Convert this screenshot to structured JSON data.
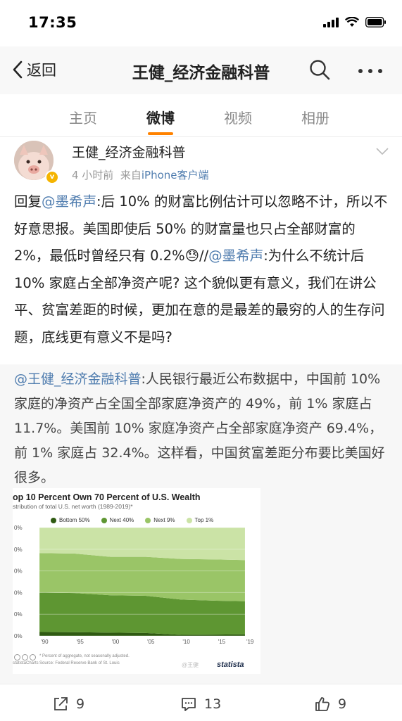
{
  "status_bar": {
    "time": "17:35"
  },
  "navbar": {
    "back_label": "返回",
    "title": "王健_经济金融科普"
  },
  "tabs": [
    {
      "label": "主页"
    },
    {
      "label": "微博"
    },
    {
      "label": "视频"
    },
    {
      "label": "相册"
    }
  ],
  "post": {
    "author": "王健_经济金融科普",
    "time_ago": "4 小时前",
    "source_prefix": "来自",
    "source": "iPhone客户端",
    "text": {
      "p1": "回复",
      "mention1": "@墨希声",
      "p2": ":后 10% 的财富比例估计可以忽略不计，所以不好意思报。美国即使后 50% 的财富量也只占全部财富的 2%，最低时曾经只有 0.2%",
      "emoji": "😓",
      "p3": "//",
      "mention2": "@墨希声",
      "p4": ":为什么不统计后 10% 家庭占全部净资产呢? 这个貌似更有意义，我们在讲公平、贫富差距的时候，更加在意的是最差的最穷的人的生存问题，底线更有意义不是吗?"
    }
  },
  "repost": {
    "mention": "@王健_经济金融科普",
    "text": ":人民银行最近公布数据中，中国前 10% 家庭的净资产占全国全部家庭净资产的 49%，前 1% 家庭占 11.7%。美国前 10% 家庭净资产占全部家庭净资产 69.4%，前 1% 家庭占 32.4%。这样看，中国贫富差距分布要比美国好很多。"
  },
  "chart_data": {
    "type": "area",
    "title": "op 10 Percent Own 70 Percent of U.S. Wealth",
    "subtitle": "stribution of total U.S. net worth (1989-2019)*",
    "legend": [
      "Bottom 50%",
      "Next 40%",
      "Next 9%",
      "Top 1%"
    ],
    "colors": [
      "#2f5a12",
      "#5e9632",
      "#9ac567",
      "#cbe3a6"
    ],
    "x": [
      1990,
      1995,
      2000,
      2005,
      2010,
      2015,
      2019
    ],
    "x_tick_labels": [
      "'90",
      "'95",
      "'00",
      "'05",
      "'10",
      "'15",
      "'19"
    ],
    "y_tick_labels": [
      "0%",
      "0%",
      "0%",
      "0%",
      "0%",
      "0%"
    ],
    "ylim": [
      0,
      100
    ],
    "stacked": true,
    "series": [
      {
        "name": "Bottom 50%",
        "values": [
          3.6,
          3.4,
          3.0,
          2.7,
          1.0,
          1.2,
          1.5
        ]
      },
      {
        "name": "Next 40%",
        "values": [
          36.4,
          36.1,
          34.5,
          34.3,
          32.5,
          31.3,
          30.5
        ]
      },
      {
        "name": "Next 9%",
        "values": [
          36.5,
          36.5,
          35.5,
          36.0,
          37.5,
          38.0,
          38.0
        ]
      },
      {
        "name": "Top 1%",
        "values": [
          23.5,
          24.0,
          27.0,
          27.0,
          29.0,
          29.5,
          30.0
        ]
      }
    ],
    "footnote": "* Percent of aggregate, not seasonally adjusted.",
    "source_note": "Source: Federal Reserve Bank of St. Louis",
    "credit": "statistaCharts",
    "brand": "statista",
    "watermark": "@王健"
  },
  "actions": {
    "reposts": "9",
    "comments": "13",
    "likes": "9"
  }
}
